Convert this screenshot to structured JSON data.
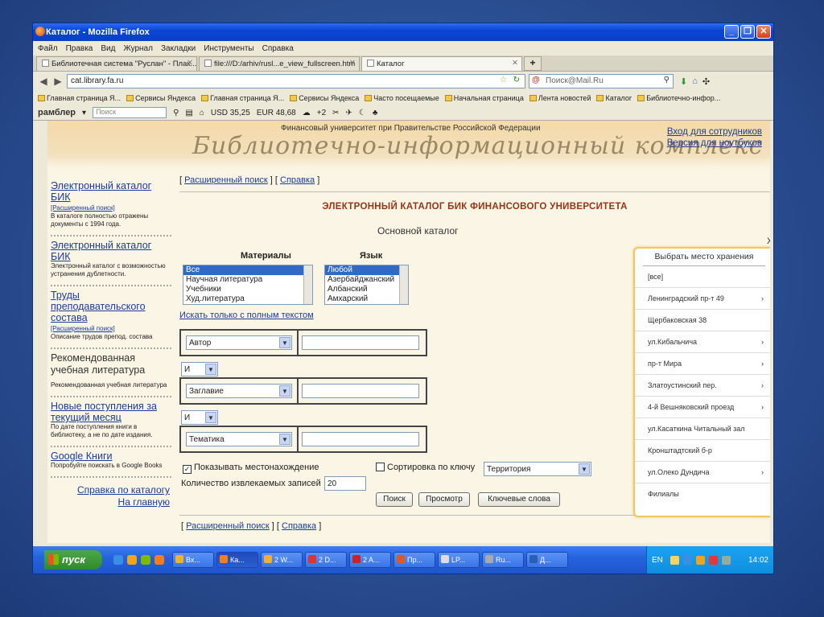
{
  "window": {
    "title": "Каталог - Mozilla Firefox",
    "menu": [
      "Файл",
      "Правка",
      "Вид",
      "Журнал",
      "Закладки",
      "Инструменты",
      "Справка"
    ],
    "tabs": [
      {
        "label": "Библиотечная система \"Руслан\" - Плак..."
      },
      {
        "label": "file:///D:/arhiv/rusl...e_view_fullscreen.htm"
      },
      {
        "label": "Каталог"
      }
    ],
    "url": "cat.library.fa.ru",
    "search_placeholder": "Поиск@Mail.Ru",
    "bookmarks": [
      "Главная страница Я...",
      "Сервисы Яндекса",
      "Главная страница Я...",
      "Сервисы Яндекса",
      "Часто посещаемые",
      "Начальная страница",
      "Лента новостей",
      "Каталог",
      "Библиотечно-инфор..."
    ],
    "rambler": {
      "logo": "рамблер",
      "search_placeholder": "Поиск",
      "usd": "USD 35,25",
      "eur": "EUR 48,68",
      "temp": "+2"
    }
  },
  "banner": {
    "university": "Финансовый университет при Правительстве Российской Федерации",
    "script_title": "Библиотечно-информационный комплекс",
    "staff_link": "Вход для сотрудников",
    "laptop_link": "Версия для ноутбуков"
  },
  "sidebar": {
    "e_catalog": "Электронный каталог БИК",
    "e_catalog_ext": "[Расширенный поиск]",
    "e_catalog_note": "В каталоге полностью отражены документы с 1994 года.",
    "e_catalog2": "Электронный каталог БИК",
    "e_catalog2_note": "Электронный каталог с возможностью устранения дублетности.",
    "works": "Труды преподавательского состава",
    "works_ext": "[Расширенный поиск]",
    "works_note": "Описание трудов препод. состава",
    "recommended": "Рекомендованная учебная литература",
    "recommended_note": "Рекомендованная учебная литература",
    "new_arrivals": "Новые поступления за текущий месяц",
    "new_arrivals_note": "По дате поступления книги в библиотеку, а не по дате издания.",
    "google_books": "Google Книги",
    "google_books_note": "Попробуйте поискать в Google Books",
    "help": "Справка по каталогу",
    "home": "На главную"
  },
  "main": {
    "ext_search": "Расширенный поиск",
    "help": "Справка",
    "heading": "ЭЛЕКТРОННЫЙ КАТАЛОГ БИК ФИНАНСОВОГО УНИВЕРСИТЕТА",
    "subheading": "Основной каталог",
    "materials_label": "Материалы",
    "materials": [
      "Все",
      "Научная литература",
      "Учебники",
      "Худ.литература"
    ],
    "language_label": "Язык",
    "languages": [
      "Любой",
      "Азербайджанский",
      "Албанский",
      "Амхарский"
    ],
    "fulltext_link": "Искать только с полным текстом",
    "field1": "Автор",
    "op1": "И",
    "field2": "Заглавие",
    "op2": "И",
    "field3": "Тематика",
    "show_location": "Показывать местонахождение",
    "sort_by_key": "Сортировка по ключу",
    "sort_value": "Территория",
    "records_label": "Количество извлекаемых записей",
    "records_value": "20",
    "search_btn": "Поиск",
    "browse_btn": "Просмотр",
    "keywords_btn": "Ключевые слова",
    "close_x": "X"
  },
  "popup": {
    "title": "Выбрать место хранения",
    "items": [
      {
        "label": "[все]",
        "chev": ""
      },
      {
        "label": "Ленинградский пр-т 49",
        "chev": "›"
      },
      {
        "label": "Щербаковская 38",
        "chev": ""
      },
      {
        "label": "ул.Кибальчича",
        "chev": "›"
      },
      {
        "label": "пр-т Мира",
        "chev": "›"
      },
      {
        "label": "Златоустинский пер.",
        "chev": "›"
      },
      {
        "label": "4-й Вешняковский проезд",
        "chev": "›"
      },
      {
        "label": "ул.Касаткина Читальный зал",
        "chev": ""
      },
      {
        "label": "Кронштадтский б-р",
        "chev": ""
      },
      {
        "label": "ул.Олеко Дундича",
        "chev": "›"
      },
      {
        "label": "Филиалы",
        "chev": ""
      }
    ]
  },
  "taskbar": {
    "start": "пуск",
    "tasks": [
      "Вх...",
      "Ка...",
      "2 W...",
      "2 D...",
      "2 A...",
      "Пр...",
      "LP...",
      "Ru...",
      "Д..."
    ],
    "lang": "EN",
    "clock": "14:02"
  }
}
